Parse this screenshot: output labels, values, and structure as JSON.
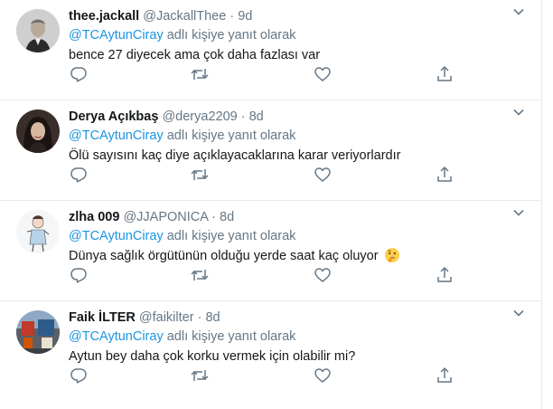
{
  "tweets": [
    {
      "name": "thee.jackall",
      "handle": "@JackallThee",
      "separator": "·",
      "time": "9d",
      "reply_mention": "@TCAytunCiray",
      "reply_suffix": " adlı kişiye yanıt olarak",
      "text": "bence 27 diyecek ama çok daha fazlası var",
      "avatar_icon": "portrait-photo"
    },
    {
      "name": "Derya Açıkbaş",
      "handle": "@derya2209",
      "separator": "·",
      "time": "8d",
      "reply_mention": "@TCAytunCiray",
      "reply_suffix": " adlı kişiye yanıt olarak",
      "text": "Ölü sayısını kaç diye açıklayacaklarına karar veriyorlardır",
      "avatar_icon": "portrait-photo"
    },
    {
      "name": "zlha 009",
      "handle": "@JJAPONICA",
      "separator": "·",
      "time": "8d",
      "reply_mention": "@TCAytunCiray",
      "reply_suffix": " adlı kişiye yanıt olarak",
      "text": "Dünya sağlık örgütünün olduğu yerde saat kaç oluyor ",
      "emoji": "thinking-face-emoji",
      "avatar_icon": "illustration"
    },
    {
      "name": "Faik İLTER",
      "handle": "@faikilter",
      "separator": "·",
      "time": "8d",
      "reply_mention": "@TCAytunCiray",
      "reply_suffix": " adlı kişiye yanıt olarak",
      "text": "Aytun bey daha çok korku vermek için olabilir mi?",
      "avatar_icon": "street-photo"
    }
  ],
  "colors": {
    "link": "#1b95e0",
    "secondary_text": "#657786",
    "primary_text": "#14171a",
    "divider": "#e6ecf0"
  }
}
